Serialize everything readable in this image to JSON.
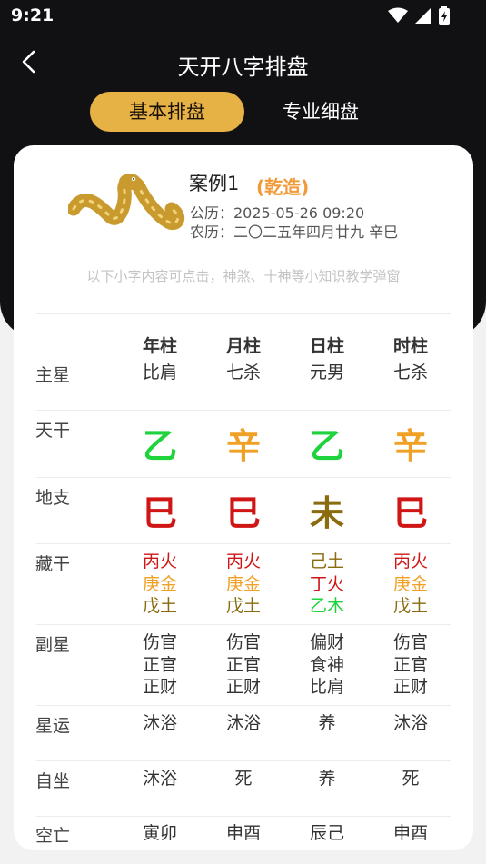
{
  "status": {
    "time": "9:21"
  },
  "nav": {
    "title": "天开八字排盘"
  },
  "tabs": {
    "basic": "基本排盘",
    "pro": "专业细盘"
  },
  "case": {
    "name": "案例1",
    "tag": "(乾造)",
    "solar": "公历：2025-05-26 09:20",
    "lunar": "农历：二〇二五年四月廿九 辛巳"
  },
  "hint": "以下小字内容可点击，神煞、十神等小知识教学弹窗",
  "columns": [
    "年柱",
    "月柱",
    "日柱",
    "时柱"
  ],
  "rows": {
    "zhuxing": {
      "label": "主星",
      "values": [
        "比肩",
        "七杀",
        "元男",
        "七杀"
      ]
    },
    "tiangan": {
      "label": "天干",
      "values": [
        "乙",
        "辛",
        "乙",
        "辛"
      ]
    },
    "dizhi": {
      "label": "地支",
      "values": [
        "巳",
        "巳",
        "未",
        "巳"
      ]
    },
    "canggan": {
      "label": "藏干",
      "values": [
        [
          "丙火",
          "庚金",
          "戊土"
        ],
        [
          "丙火",
          "庚金",
          "戊土"
        ],
        [
          "己土",
          "丁火",
          "乙木"
        ],
        [
          "丙火",
          "庚金",
          "戊土"
        ]
      ]
    },
    "fuxing": {
      "label": "副星",
      "values": [
        [
          "伤官",
          "正官",
          "正财"
        ],
        [
          "伤官",
          "正官",
          "正财"
        ],
        [
          "偏财",
          "食神",
          "比肩"
        ],
        [
          "伤官",
          "正官",
          "正财"
        ]
      ]
    },
    "xingyun": {
      "label": "星运",
      "values": [
        "沐浴",
        "沐浴",
        "养",
        "沐浴"
      ]
    },
    "zizuo": {
      "label": "自坐",
      "values": [
        "沐浴",
        "死",
        "养",
        "死"
      ]
    },
    "kongwang": {
      "label": "空亡",
      "values": [
        "寅卯",
        "申酉",
        "辰己",
        "申酉"
      ]
    }
  },
  "colors": {
    "wood": "#1fd33c",
    "metal": "#f0a024",
    "fire": "#d01515",
    "earth": "#8a6b0e",
    "accent": "#e6b245"
  }
}
